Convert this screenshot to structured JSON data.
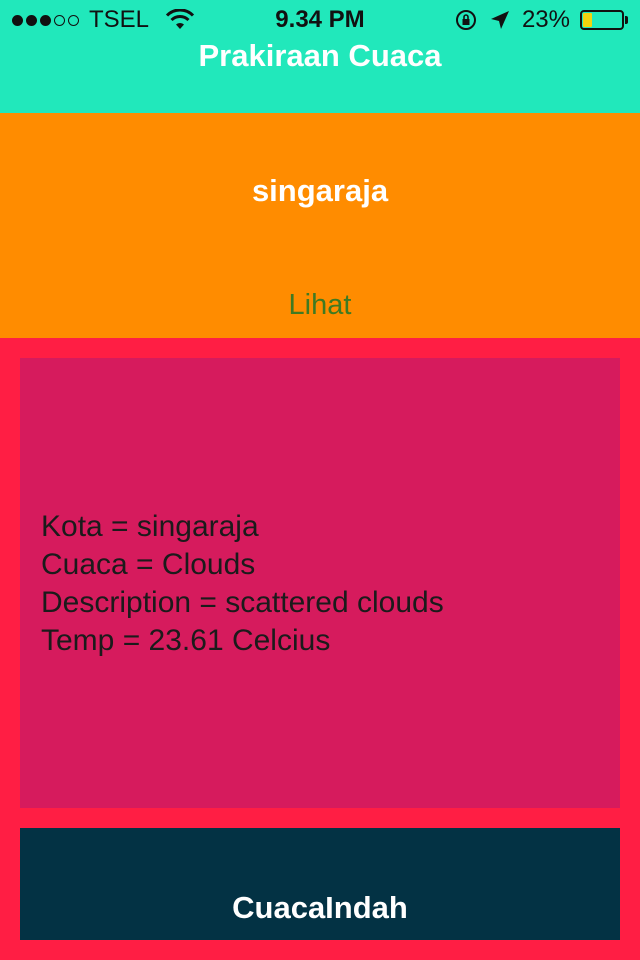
{
  "status_bar": {
    "signal_full": 3,
    "signal_total": 5,
    "carrier": "TSEL",
    "time": "9.34 PM",
    "battery_percent_text": "23%",
    "battery_level": 0.23,
    "icons": [
      "wifi-icon",
      "rotation-lock-icon",
      "location-arrow-icon",
      "battery-icon"
    ]
  },
  "header": {
    "title": "Prakiraan Cuaca",
    "background_color": "#21e8bb"
  },
  "search": {
    "city_value": "singaraja",
    "view_button_label": "Lihat",
    "background_color": "#ff8c00"
  },
  "result": {
    "lines": [
      "Kota = singaraja",
      "Cuaca = Clouds",
      "Description = scattered clouds",
      "Temp = 23.61 Celcius"
    ],
    "background_color": "#d61b5d"
  },
  "footer": {
    "label": "CuacaIndah",
    "background_color": "#033244"
  },
  "page_background_color": "#ff1e44"
}
